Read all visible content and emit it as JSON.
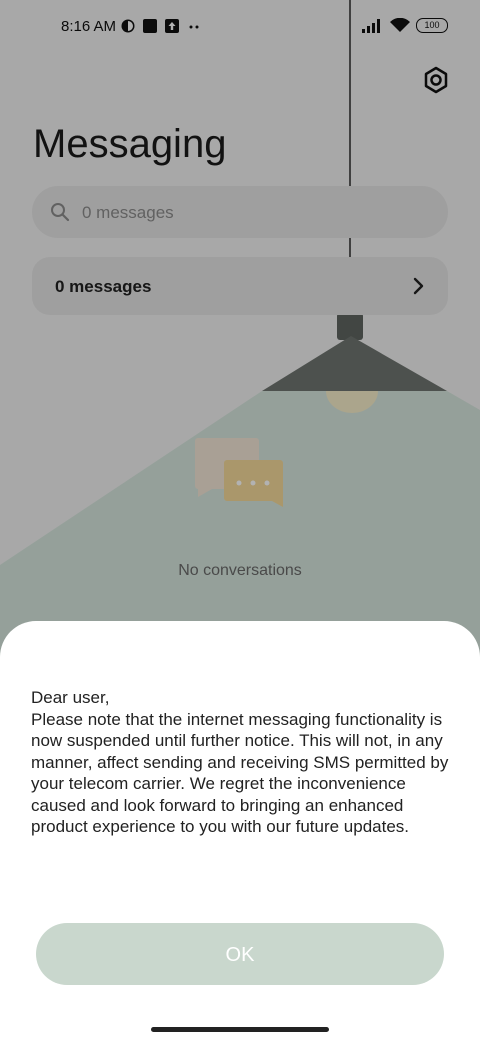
{
  "status_bar": {
    "time": "8:16 AM",
    "battery": "100"
  },
  "header": {
    "title": "Messaging",
    "settings_icon": "settings-gear-icon"
  },
  "search": {
    "placeholder": "0 messages"
  },
  "messages_row": {
    "label": "0 messages"
  },
  "empty_state": {
    "text": "No conversations"
  },
  "dialog": {
    "message": "Dear user,\nPlease note that the internet messaging functionality is now suspended until further notice. This will not, in any manner, affect sending and receiving SMS permitted by your telecom carrier. We regret the inconvenience caused and look forward to bringing an enhanced product experience to you with our future updates.",
    "ok_label": "OK"
  },
  "colors": {
    "ok_button": "#c9d7cd",
    "lamp_shade": "#6f7570",
    "lamp_light": "#d6e6dd"
  }
}
